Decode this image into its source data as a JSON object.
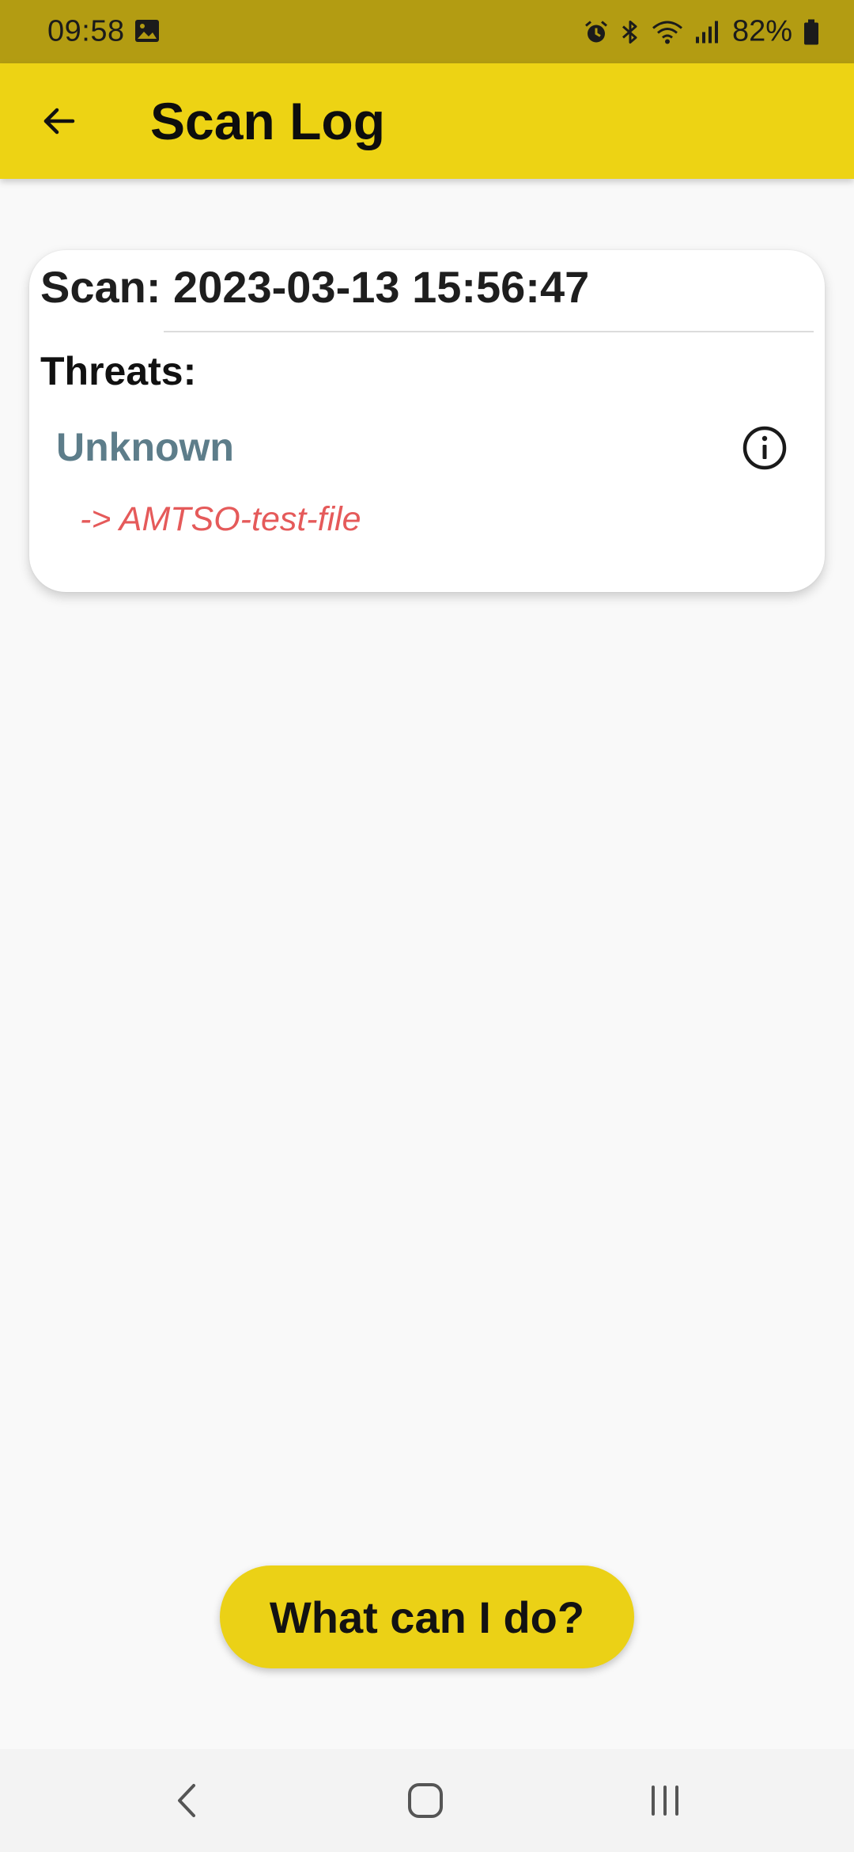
{
  "status_bar": {
    "time": "09:58",
    "battery": "82%",
    "icons": [
      "image-icon",
      "alarm-icon",
      "bluetooth-icon",
      "wifi-icon",
      "signal-icon",
      "battery-icon"
    ]
  },
  "app_bar": {
    "title": "Scan Log",
    "back_icon": "arrow-left-icon"
  },
  "scan": {
    "title": "Scan: 2023-03-13 15:56:47",
    "threats_label": "Threats:",
    "threats": [
      {
        "name": "Unknown",
        "file": "-> AMTSO-test-file",
        "icon": "info-icon"
      }
    ]
  },
  "action": {
    "label": "What can I do?"
  },
  "nav": {
    "items": [
      "back-nav-icon",
      "home-nav-icon",
      "recents-nav-icon"
    ]
  },
  "colors": {
    "status_bar": "#b39c12",
    "app_bar": "#edd314",
    "accent_button": "#ebd116",
    "threat_name": "#5d7d8a",
    "threat_file": "#e55a5a",
    "background": "#f9f9f9"
  }
}
